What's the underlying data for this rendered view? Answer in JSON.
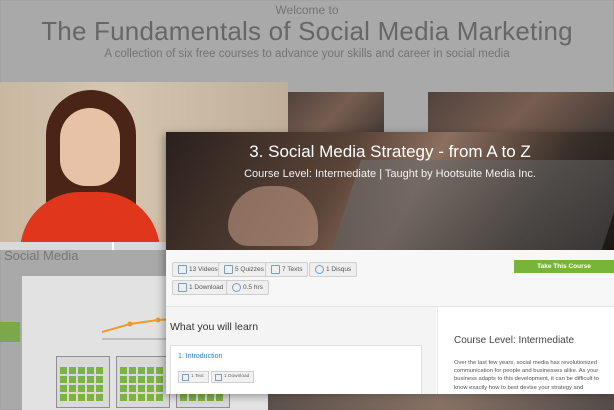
{
  "background": {
    "welcome": "Welcome to",
    "title": "The Fundamentals of Social Media Marketing",
    "subtitle": "A collection of six free courses to advance your skills and career in social media",
    "side_label": "Social Media"
  },
  "modal": {
    "title": "3. Social Media Strategy - from A to Z",
    "meta": "Course Level: Intermediate | Taught by Hootsuite Media Inc.",
    "stats": [
      {
        "label": "13 Videos",
        "icon": "video-icon"
      },
      {
        "label": "5 Quizzes",
        "icon": "quiz-icon"
      },
      {
        "label": "7 Texts",
        "icon": "text-icon"
      },
      {
        "label": "1 Disqus",
        "icon": "comment-icon"
      },
      {
        "label": "1 Download",
        "icon": "download-icon"
      },
      {
        "label": "0.5 hrs",
        "icon": "clock-icon"
      }
    ],
    "cta": "Take This Course",
    "learn_heading": "What you will learn",
    "lesson": {
      "title": "1. Introduction",
      "chips": [
        "1 Text",
        "1 Download"
      ]
    },
    "side_heading": "Course Level: Intermediate",
    "side_text": "Over the last few years, social media has revolutionized communication for people and businesses alike. As your business adapts to this development, it can be difficult to know exactly how to best devise your strategy and"
  },
  "colors": {
    "accent_green": "#79b43a",
    "link_blue": "#2b7bb9"
  }
}
